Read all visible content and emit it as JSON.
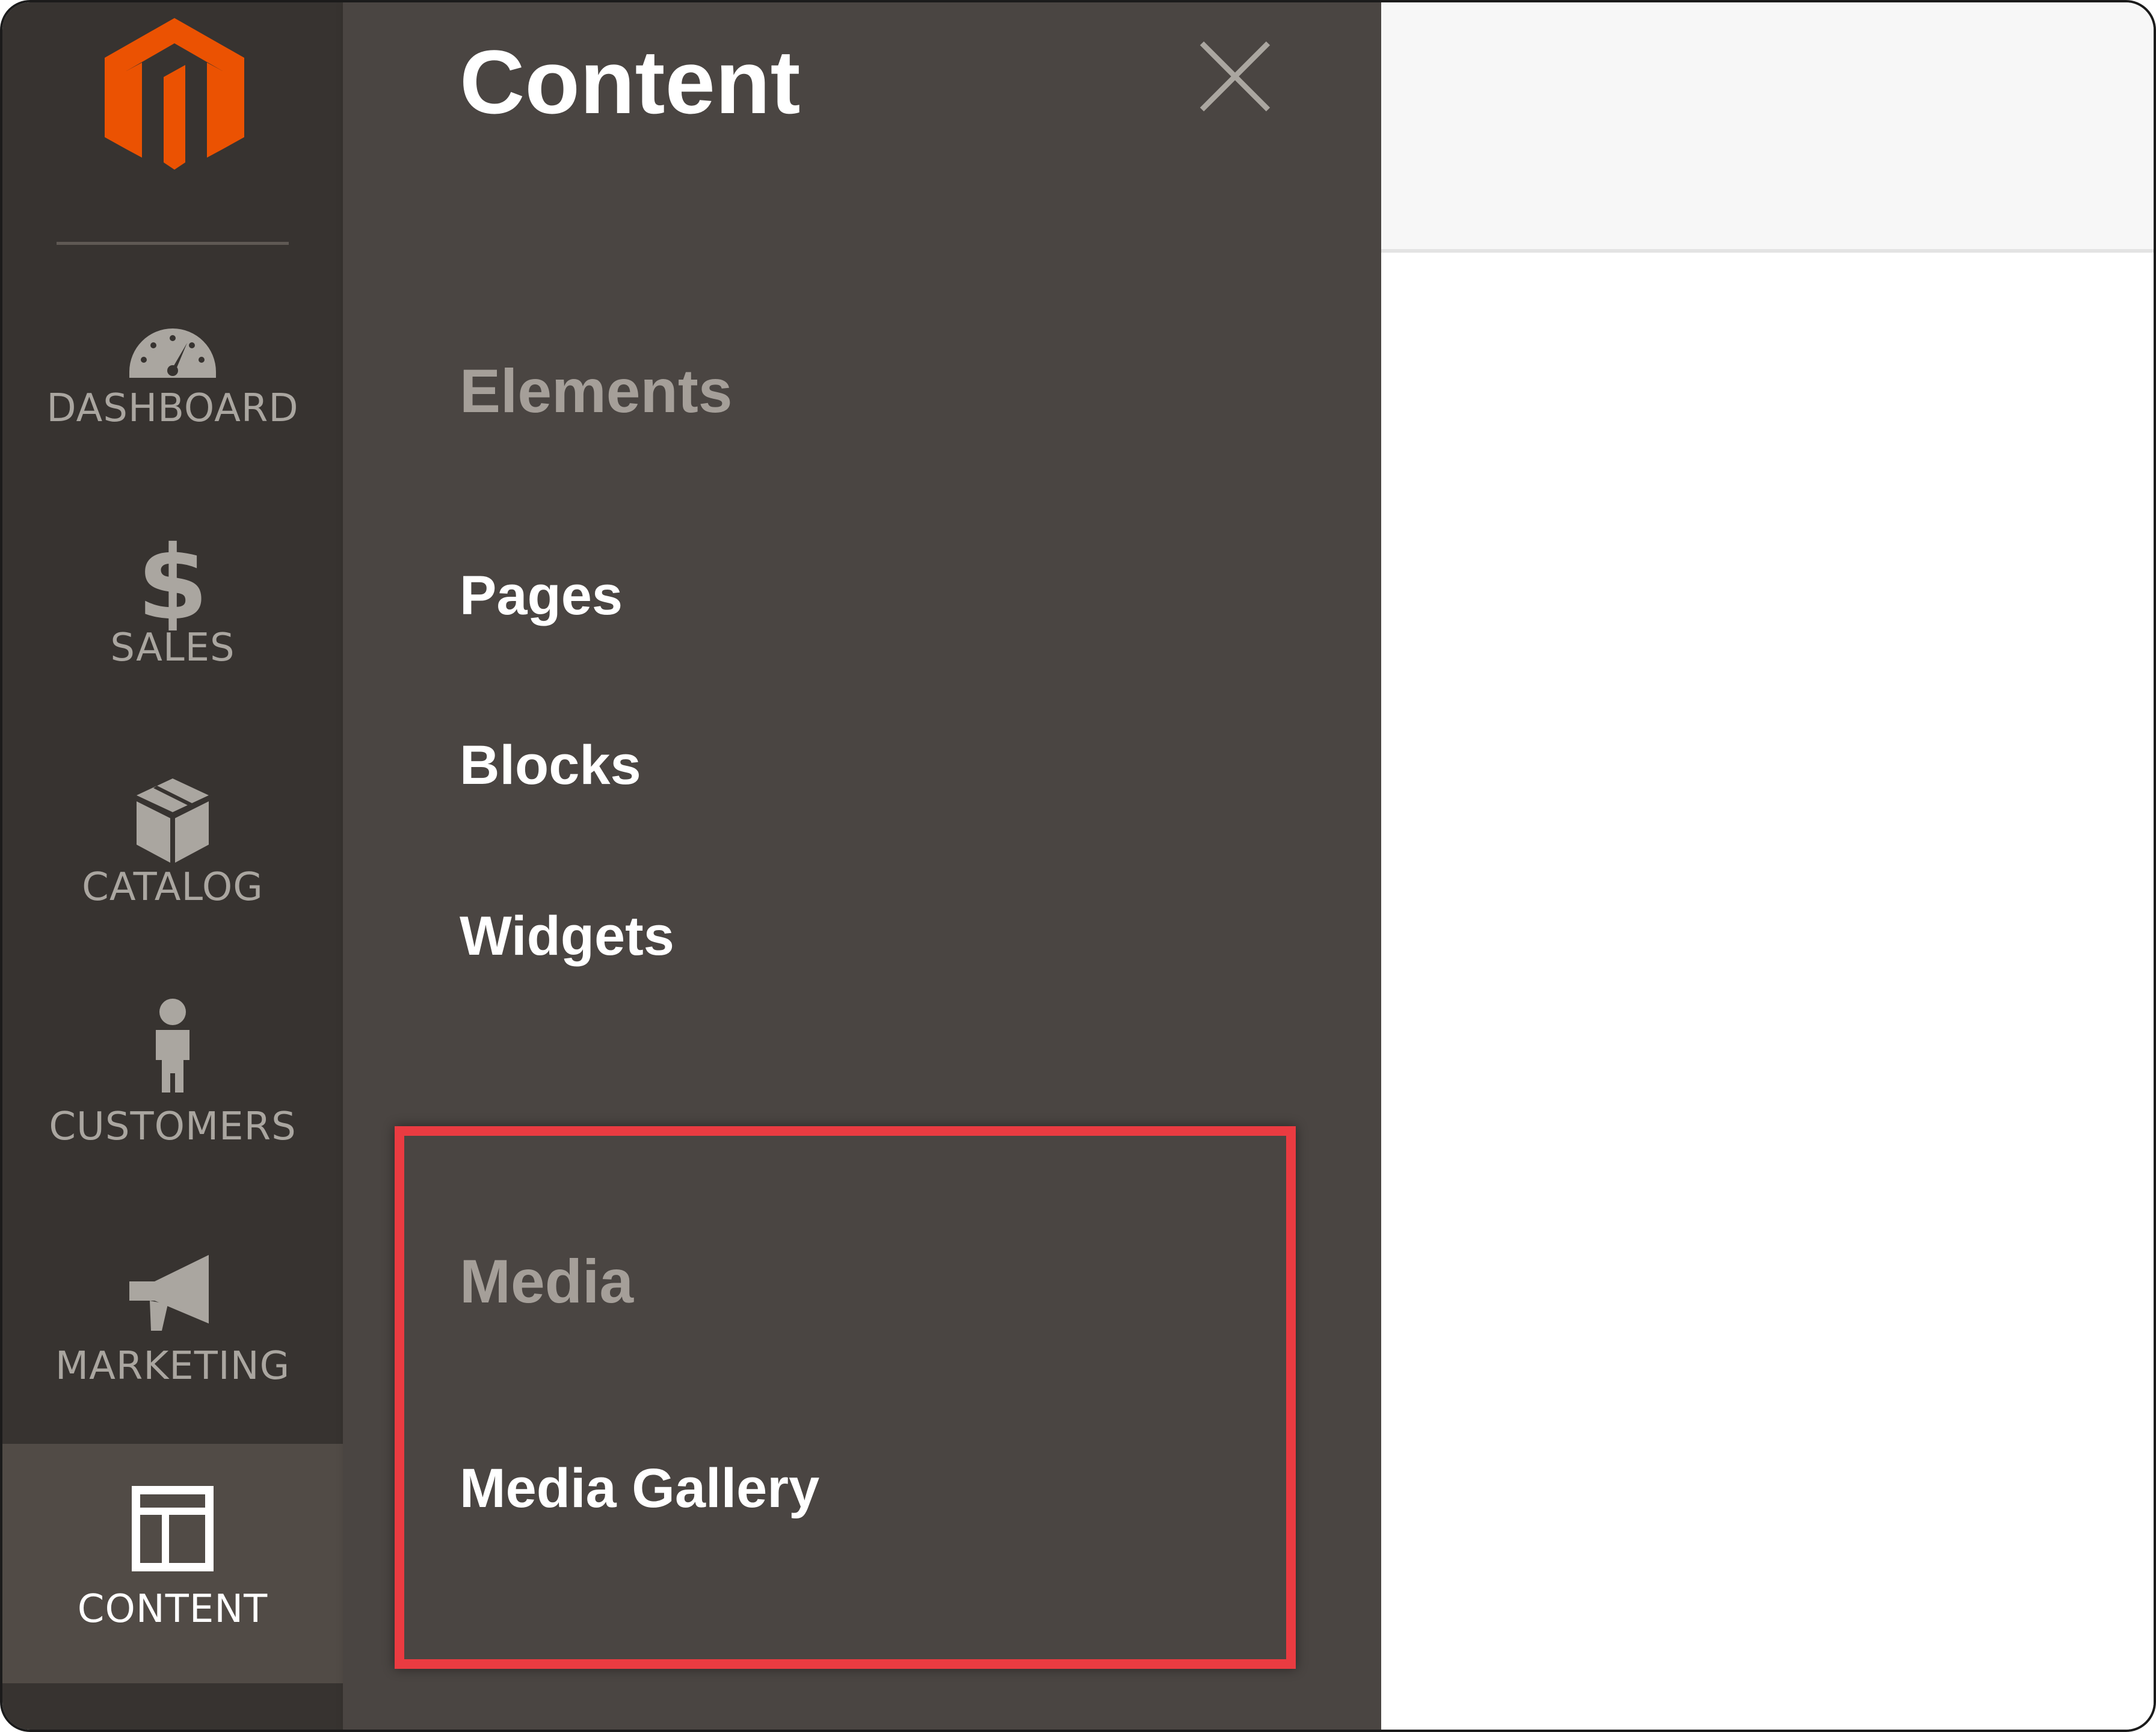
{
  "colors": {
    "nav_bg": "#373330",
    "nav_active_bg": "#514b46",
    "flyout_bg": "#4a4542",
    "logo_orange": "#eb5202",
    "highlight_red": "#ea3b41",
    "muted_text": "#a59f99"
  },
  "nav": {
    "logo": "magento-logo",
    "items": [
      {
        "label": "DASHBOARD",
        "icon": "speedometer-icon",
        "active": false
      },
      {
        "label": "SALES",
        "icon": "dollar-icon",
        "active": false
      },
      {
        "label": "CATALOG",
        "icon": "box-icon",
        "active": false
      },
      {
        "label": "CUSTOMERS",
        "icon": "person-icon",
        "active": false
      },
      {
        "label": "MARKETING",
        "icon": "megaphone-icon",
        "active": false
      },
      {
        "label": "CONTENT",
        "icon": "layout-icon",
        "active": true
      }
    ]
  },
  "flyout": {
    "title": "Content",
    "close_icon": "close-icon",
    "sections": [
      {
        "title": "Elements",
        "links": [
          "Pages",
          "Blocks",
          "Widgets"
        ]
      },
      {
        "title": "Media",
        "links": [
          "Media Gallery"
        ]
      }
    ]
  }
}
